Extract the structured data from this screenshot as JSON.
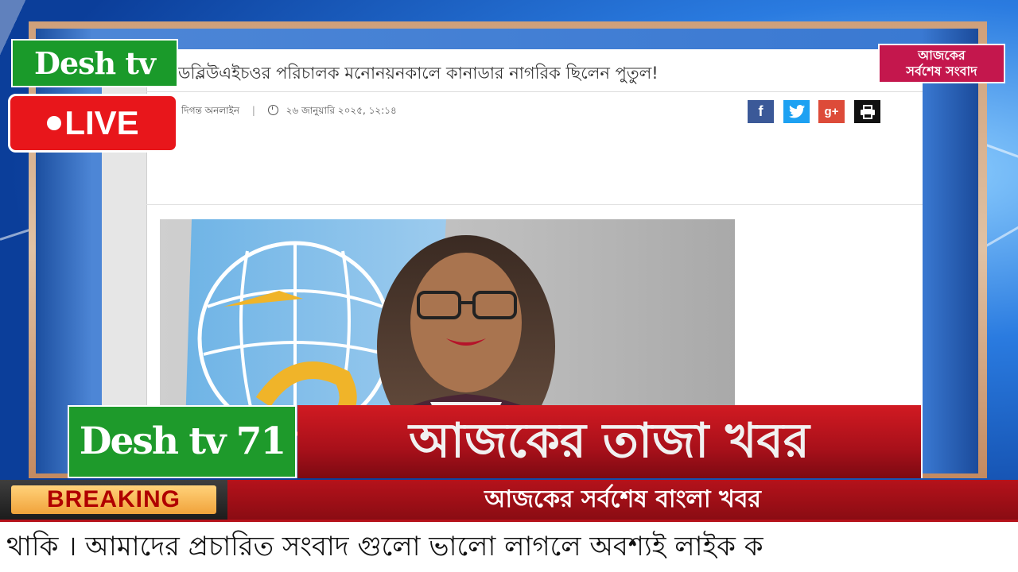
{
  "article": {
    "headline": "ডব্লিউএইচওর পরিচালক মনোনয়নকালে কানাডার নাগরিক ছিলেন পুতুল!",
    "author": "দিগন্ত অনলাইন",
    "date": "২৬ জানুয়ারি ২০২৫, ১২:১৪",
    "share_icons": [
      "facebook-icon",
      "twitter-icon",
      "google-plus-icon",
      "print-icon"
    ]
  },
  "channel": {
    "logo_text": "Desh tv 71",
    "live_label": "LIVE",
    "corner_logo_line1": "আজকের",
    "corner_logo_line2": "সর্বশেষ সংবাদ"
  },
  "lower_third": {
    "logo_text": "Desh tv 71",
    "title": "আজকের তাজা খবর",
    "breaking_label": "BREAKING",
    "subtitle": "আজকের সর্বশেষ বাংলা খবর",
    "ticker": "থাকি । আমাদের প্রচারিত সংবাদ গুলো ভালো লাগলে অবশ্যই লাইক ক"
  },
  "colors": {
    "live_red": "#e8161b",
    "logo_green": "#1a9a2a",
    "band_red": "#b5121b",
    "breaking_gold": "#f1a33b"
  }
}
